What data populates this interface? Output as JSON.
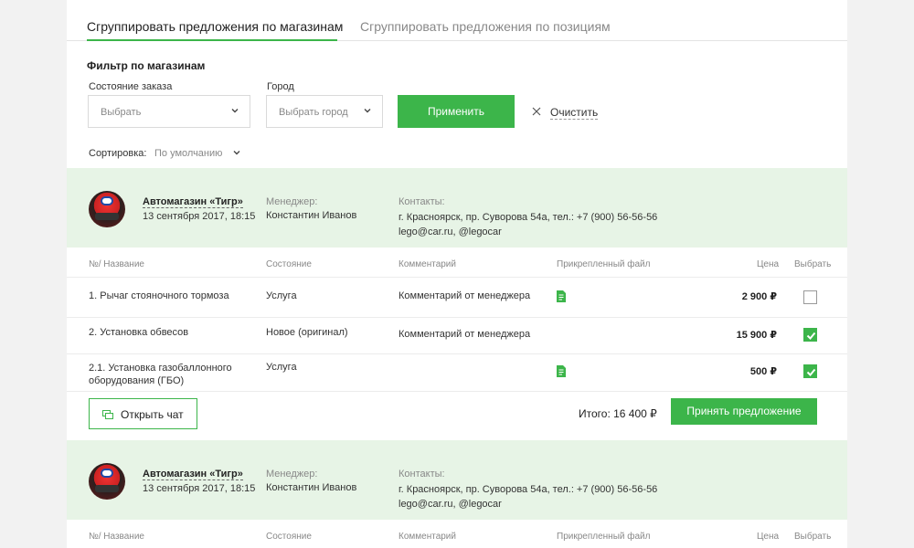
{
  "tabs": {
    "by_shops": "Сгруппировать предложения по магазинам",
    "by_items": "Сгруппировать предложения по позициям"
  },
  "filter": {
    "title": "Фильтр по магазинам",
    "order_state_label": "Состояние заказа",
    "order_state_value": "Выбрать",
    "city_label": "Город",
    "city_value": "Выбрать город",
    "apply": "Применить",
    "clear": "Очистить"
  },
  "sort": {
    "label": "Сортировка:",
    "value": "По умолчанию"
  },
  "columns": [
    "№/ Название",
    "Состояние",
    "Комментарий",
    "Прикрепленный файл",
    "Цена",
    "Выбрать"
  ],
  "shops": [
    {
      "name": "Автомагазин «Тигр»",
      "date": "13 сентября 2017, 18:15",
      "manager_label": "Менеджер:",
      "manager": "Константин Иванов",
      "contacts_label": "Контакты:",
      "contacts_line1": "г. Красноярск, пр. Суворова 54а, тел.: +7 (900) 56-56-56",
      "contacts_line2": "lego@car.ru, @legocar",
      "rows": [
        {
          "name": "1. Рычаг стояночного тормоза",
          "state": "Услуга",
          "comment": "Комментарий от менеджера",
          "file": true,
          "price": "2 900 ₽",
          "selected": false
        },
        {
          "name": "2. Установка обвесов",
          "state": "Новое (оригинал)",
          "comment": "Комментарий от менеджера",
          "file": false,
          "price": "15  900 ₽",
          "selected": true
        },
        {
          "name": "2.1. Установка газобаллонного оборудования (ГБО)",
          "state": "Услуга",
          "comment": "",
          "file": true,
          "price": "500 ₽",
          "selected": true
        }
      ],
      "open_chat": "Открыть чат",
      "total": "Итого: 16 400 ₽",
      "accept": "Принять предложение"
    },
    {
      "name": "Автомагазин «Тигр»",
      "date": "13 сентября 2017, 18:15",
      "manager_label": "Менеджер:",
      "manager": "Константин Иванов",
      "contacts_label": "Контакты:",
      "contacts_line1": "г. Красноярск, пр. Суворова 54а, тел.: +7 (900) 56-56-56",
      "contacts_line2": "lego@car.ru, @legocar"
    }
  ],
  "colors": {
    "accent": "#3cb54a",
    "shop_header_bg": "#e7f4e6"
  }
}
